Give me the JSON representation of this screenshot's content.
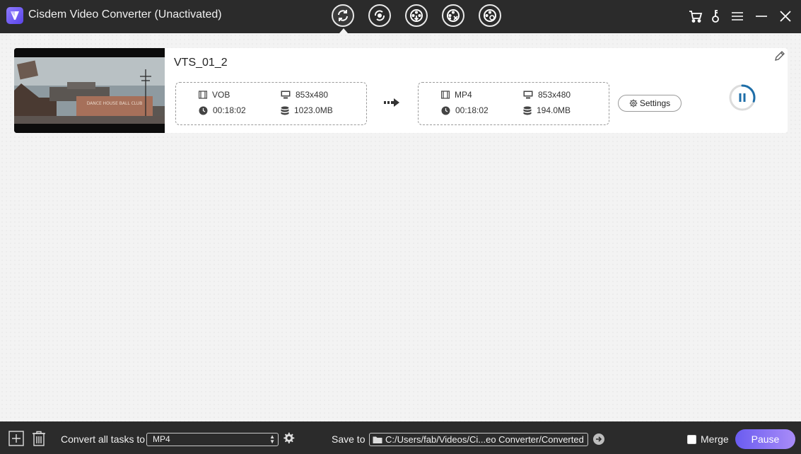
{
  "app": {
    "title": "Cisdem Video Converter (Unactivated)"
  },
  "task": {
    "file_name": "VTS_01_2",
    "source": {
      "format": "VOB",
      "resolution": "853x480",
      "duration": "00:18:02",
      "size": "1023.0MB"
    },
    "output": {
      "format": "MP4",
      "resolution": "853x480",
      "duration": "00:18:02",
      "size": "194.0MB"
    },
    "settings_label": "Settings",
    "progress": 0.3,
    "thumbnail_sign": "DANCE HOUSE\nBALL CLUB"
  },
  "bottom": {
    "convert_label": "Convert all tasks to",
    "format_value": "MP4",
    "save_label": "Save to",
    "save_path": "C:/Users/fab/Videos/Ci...eo Converter/Converted",
    "merge_label": "Merge",
    "pause_label": "Pause"
  },
  "colors": {
    "titlebar": "#2b2b2b",
    "accent": "#6a5cf0",
    "progress": "#1e6ea8"
  }
}
